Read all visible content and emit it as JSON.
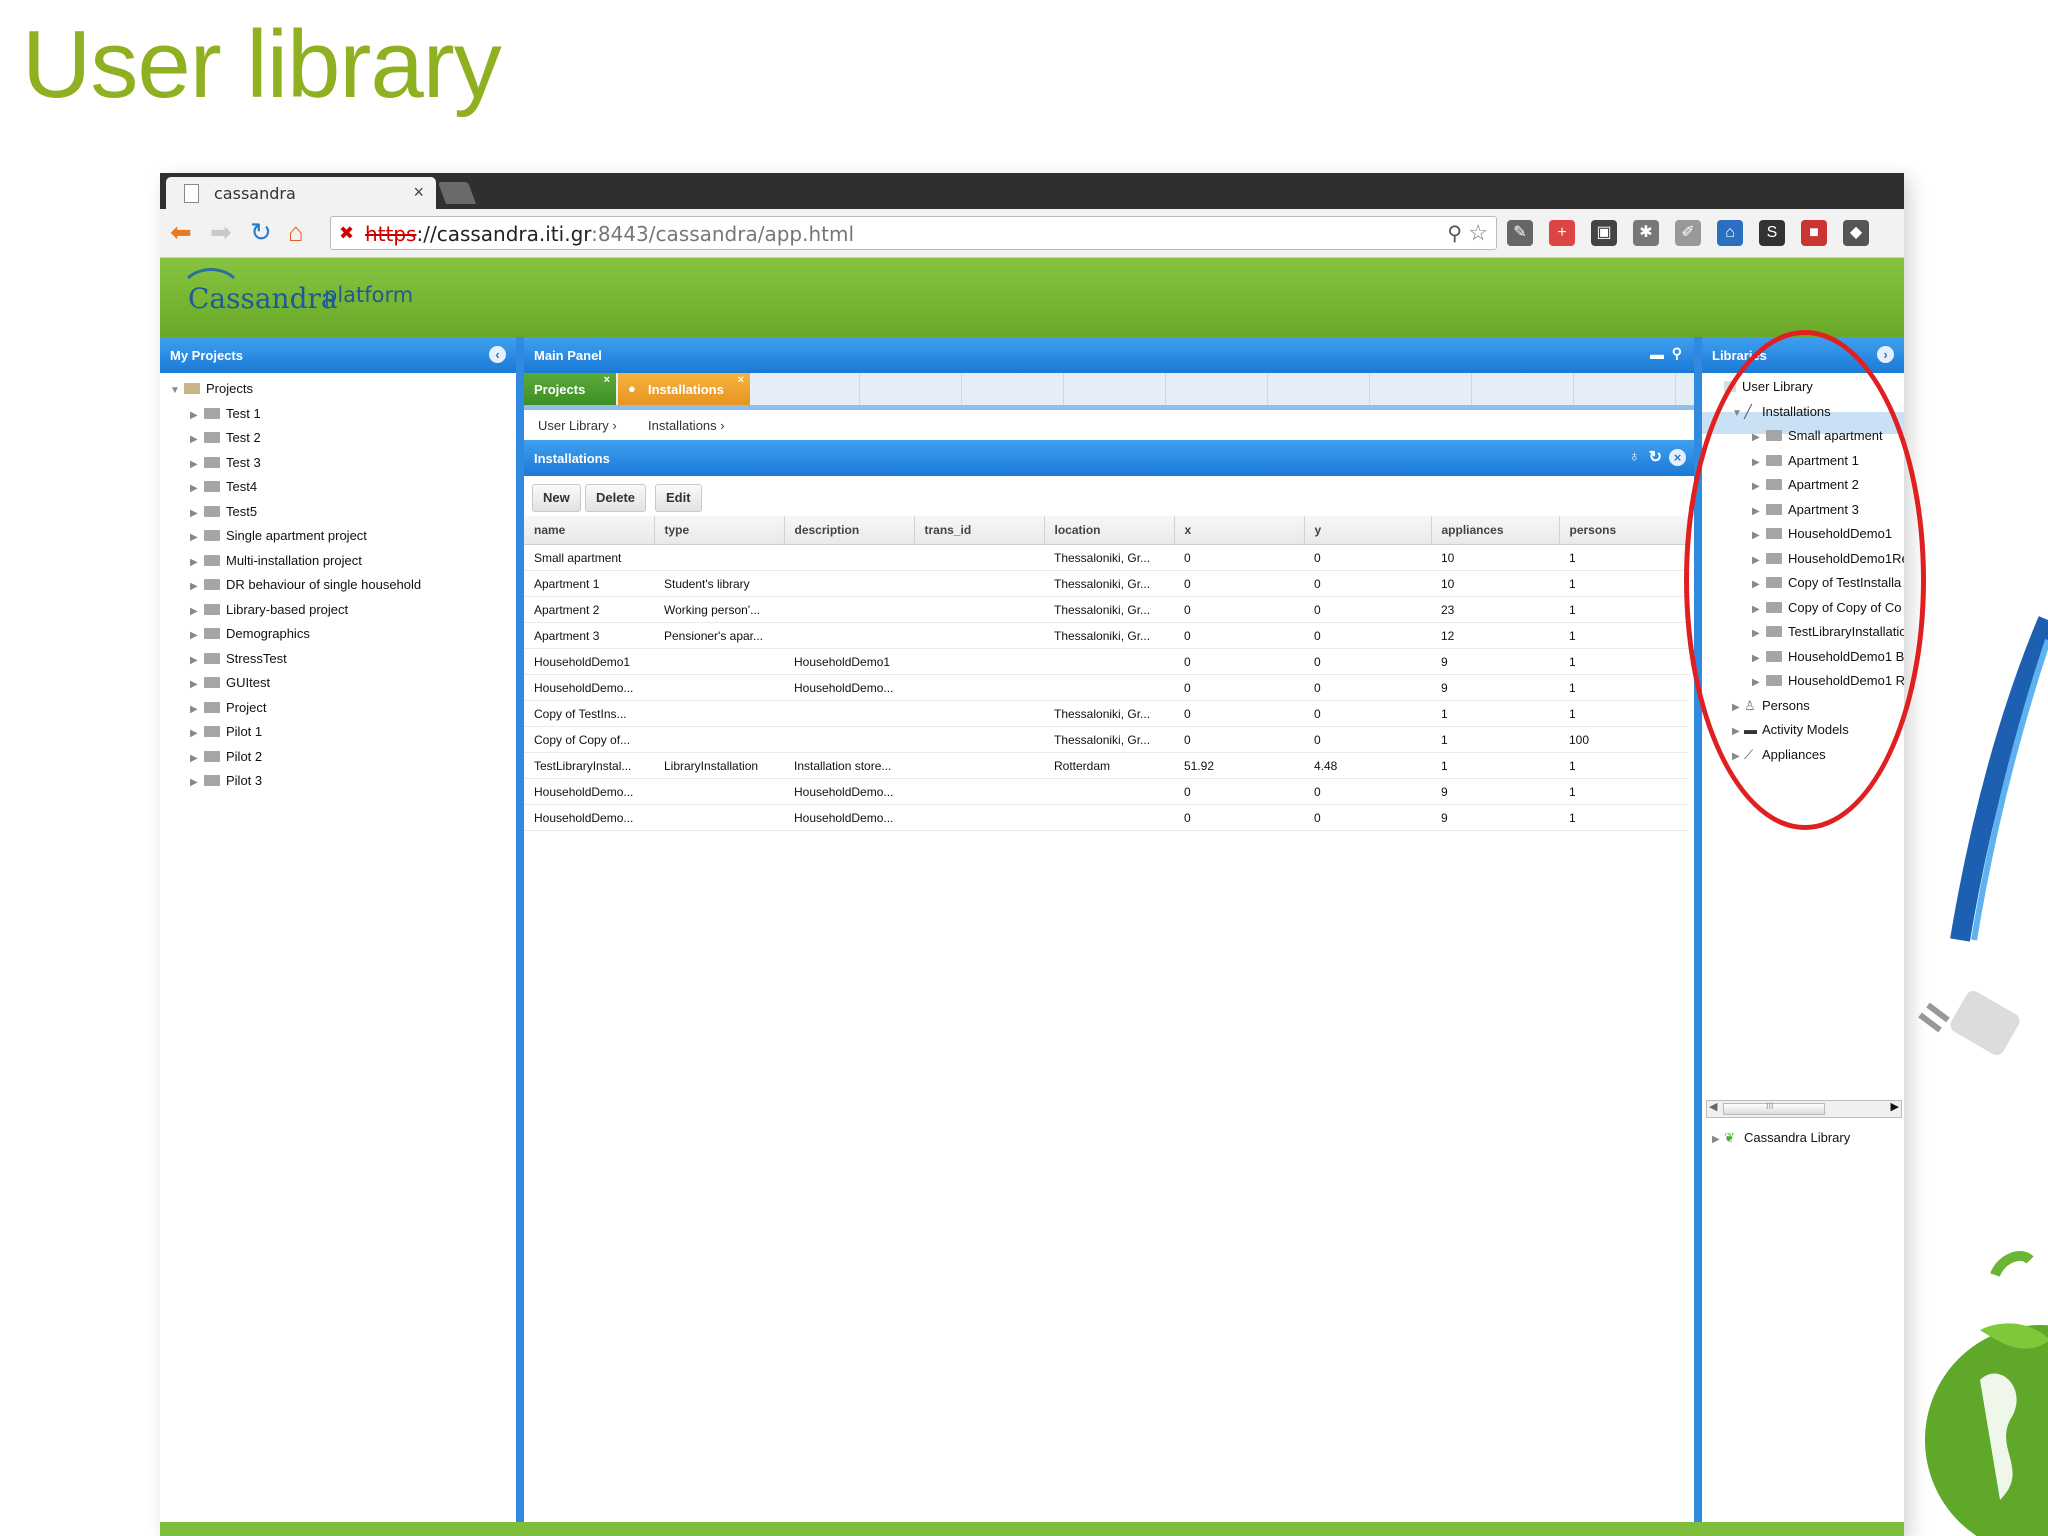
{
  "slide": {
    "title": "User library"
  },
  "browser": {
    "tab_title": "cassandra",
    "tab_close": "×",
    "url_proto": "https",
    "url_host": "://cassandra.iti.gr",
    "url_port": ":8443",
    "url_path": "/cassandra/app.html"
  },
  "app": {
    "logo": "Cassandra",
    "platform": "platform"
  },
  "left_panel": {
    "title": "My Projects",
    "root": "Projects",
    "items": [
      "Test 1",
      "Test 2",
      "Test 3",
      "Test4",
      "Test5",
      "Single apartment project",
      "Multi-installation project",
      "DR behaviour of single household",
      "Library-based project",
      "Demographics",
      "StressTest",
      "GUItest",
      "Project",
      "Pilot 1",
      "Pilot 2",
      "Pilot 3"
    ]
  },
  "main_panel": {
    "title": "Main Panel",
    "tabs": [
      {
        "label": "Projects"
      },
      {
        "label": "Installations"
      }
    ],
    "breadcrumb": [
      "User Library ›",
      "Installations ›"
    ],
    "section_title": "Installations",
    "buttons": {
      "new": "New",
      "delete": "Delete",
      "edit": "Edit"
    },
    "columns": [
      "name",
      "type",
      "description",
      "trans_id",
      "location",
      "x",
      "y",
      "appliances",
      "persons"
    ],
    "rows": [
      [
        "Small apartment",
        "",
        "",
        "",
        "Thessaloniki, Gr...",
        "0",
        "0",
        "10",
        "1"
      ],
      [
        "Apartment 1",
        "Student's library",
        "",
        "",
        "Thessaloniki, Gr...",
        "0",
        "0",
        "10",
        "1"
      ],
      [
        "Apartment 2",
        "Working person'...",
        "",
        "",
        "Thessaloniki, Gr...",
        "0",
        "0",
        "23",
        "1"
      ],
      [
        "Apartment 3",
        "Pensioner's apar...",
        "",
        "",
        "Thessaloniki, Gr...",
        "0",
        "0",
        "12",
        "1"
      ],
      [
        "HouseholdDemo1",
        "",
        "HouseholdDemo1",
        "",
        "",
        "0",
        "0",
        "9",
        "1"
      ],
      [
        "HouseholdDemo...",
        "",
        "HouseholdDemo...",
        "",
        "",
        "0",
        "0",
        "9",
        "1"
      ],
      [
        "Copy of TestIns...",
        "",
        "",
        "",
        "Thessaloniki, Gr...",
        "0",
        "0",
        "1",
        "1"
      ],
      [
        "Copy of Copy of...",
        "",
        "",
        "",
        "Thessaloniki, Gr...",
        "0",
        "0",
        "1",
        "100"
      ],
      [
        "TestLibraryInstal...",
        "LibraryInstallation",
        "Installation store...",
        "",
        "Rotterdam",
        "51.92",
        "4.48",
        "1",
        "1"
      ],
      [
        "HouseholdDemo...",
        "",
        "HouseholdDemo...",
        "",
        "",
        "0",
        "0",
        "9",
        "1"
      ],
      [
        "HouseholdDemo...",
        "",
        "HouseholdDemo...",
        "",
        "",
        "0",
        "0",
        "9",
        "1"
      ]
    ]
  },
  "right_panel": {
    "title": "Libraries",
    "user_library": "User Library",
    "installations": "Installations",
    "install_items": [
      "Small apartment",
      "Apartment 1",
      "Apartment 2",
      "Apartment 3",
      "HouseholdDemo1",
      "HouseholdDemo1Re",
      "Copy of TestInstalla",
      "Copy of Copy of Co",
      "TestLibraryInstallatio",
      "HouseholdDemo1 B",
      "HouseholdDemo1 R"
    ],
    "persons": "Persons",
    "activity_models": "Activity Models",
    "appliances": "Appliances",
    "cassandra_library": "Cassandra Library",
    "scroll_grip": "III"
  },
  "colors": {
    "title_green": "#8fb021",
    "header_green": "#78b833",
    "panel_blue": "#1a7ad6",
    "tab_orange": "#f0a030",
    "annotation_red": "#e02020"
  }
}
